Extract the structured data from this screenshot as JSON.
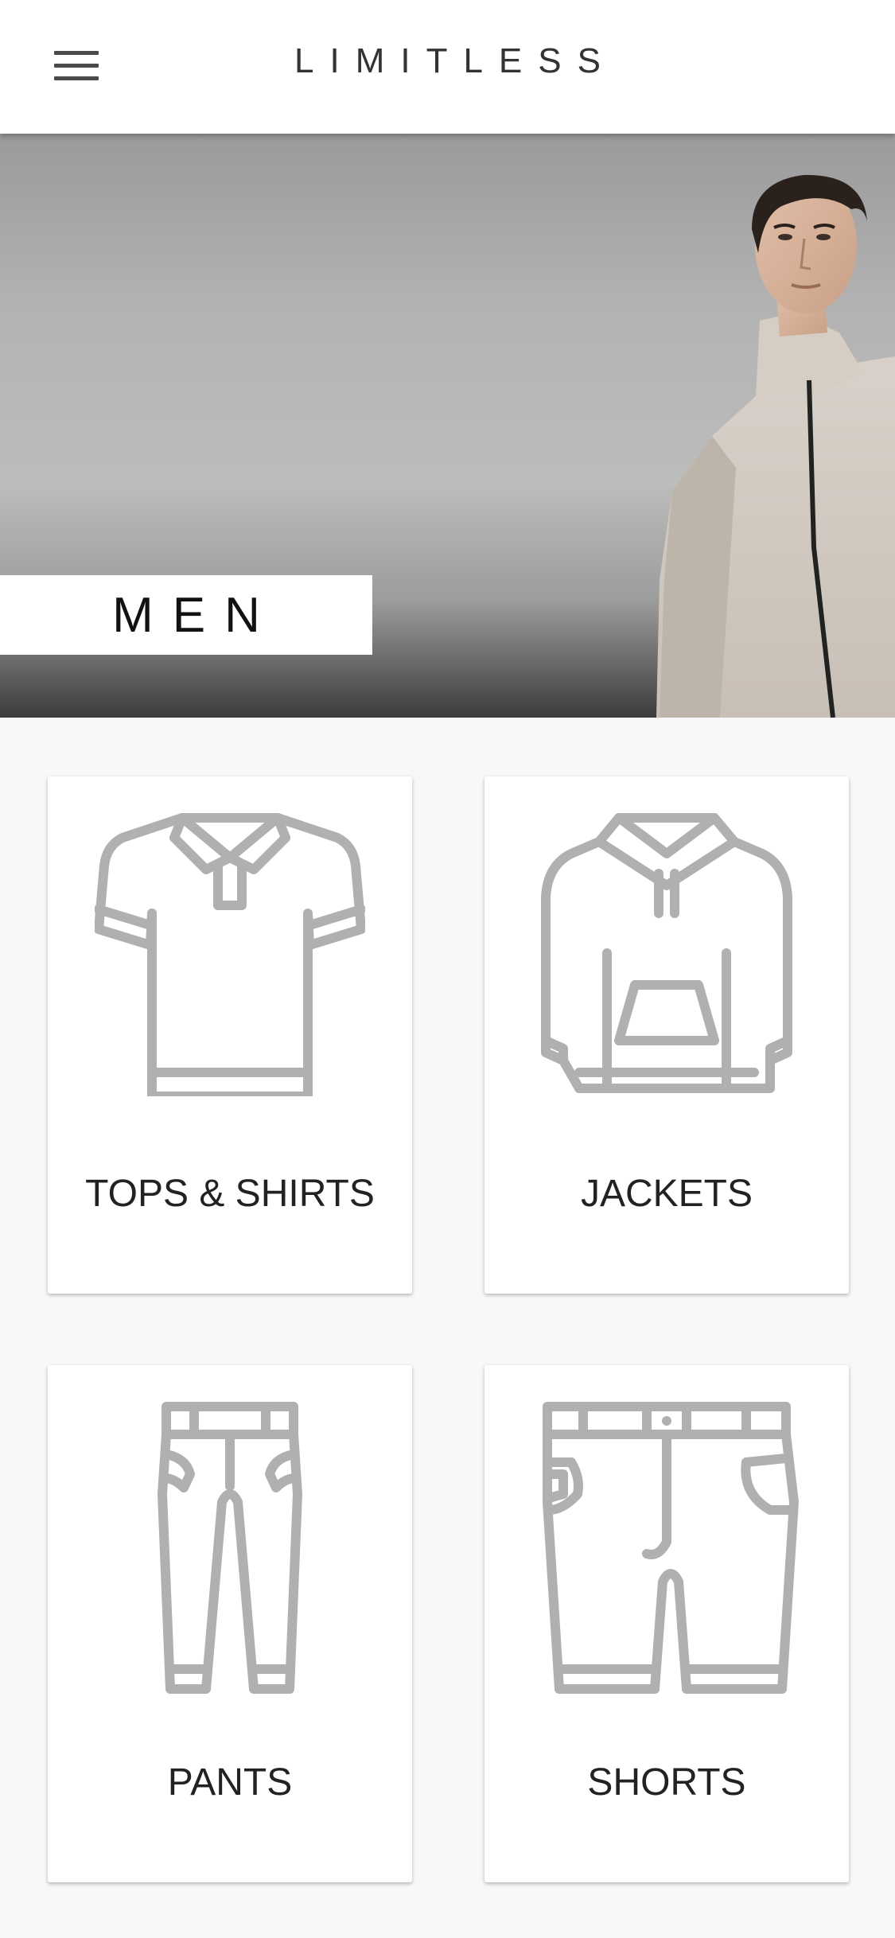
{
  "header": {
    "title": "LIMITLESS",
    "menu_icon": "hamburger-menu-icon"
  },
  "hero": {
    "label": "MEN",
    "image": "male-model-photo"
  },
  "categories": [
    {
      "label": "TOPS & SHIRTS",
      "icon": "polo-shirt-icon"
    },
    {
      "label": "JACKETS",
      "icon": "hoodie-icon"
    },
    {
      "label": "PANTS",
      "icon": "pants-icon"
    },
    {
      "label": "SHORTS",
      "icon": "shorts-icon"
    }
  ],
  "colors": {
    "icon_stroke": "#b0b0b0",
    "text": "#222222",
    "background": "#f8f8f8"
  }
}
